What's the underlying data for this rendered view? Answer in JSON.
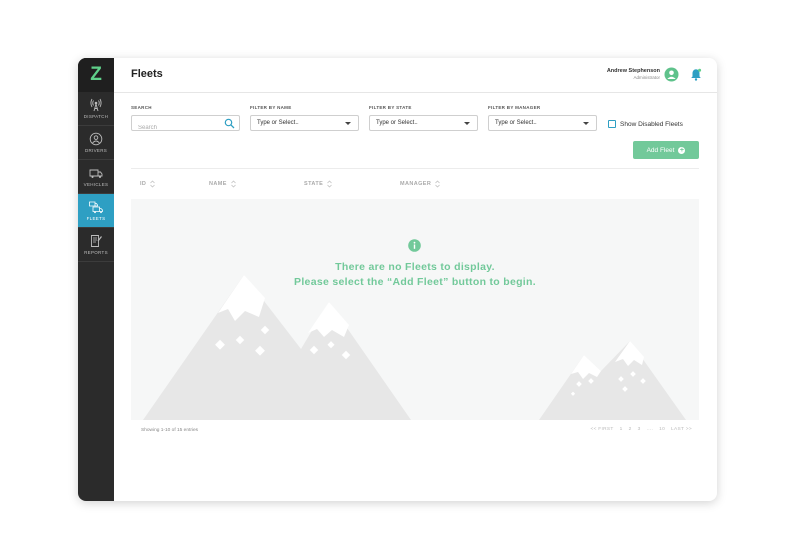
{
  "app": {
    "logo_text": "Z",
    "brand_color": "#5fd08a",
    "accent_color": "#2e9fc3"
  },
  "sidebar": {
    "items": [
      {
        "label": "DISPATCH",
        "icon": "antenna-icon"
      },
      {
        "label": "DRIVERS",
        "icon": "driver-icon"
      },
      {
        "label": "VEHICLES",
        "icon": "truck-icon"
      },
      {
        "label": "FLEETS",
        "icon": "fleet-icon",
        "active": true
      },
      {
        "label": "REPORTS",
        "icon": "report-icon"
      }
    ]
  },
  "header": {
    "title": "Fleets",
    "user_name": "Andrew Stephenson",
    "user_role": "Administrator"
  },
  "filters": {
    "search_label": "SEARCH",
    "search_placeholder": "Search",
    "name_label": "FILTER BY NAME",
    "name_value": "Type or Select..",
    "state_label": "FILTER BY STATE",
    "state_value": "Type or Select..",
    "manager_label": "FILTER BY MANAGER",
    "manager_value": "Type or Select..",
    "show_disabled_label": "Show Disabled Fleets",
    "show_disabled_checked": false
  },
  "actions": {
    "add_label": "Add Fleet"
  },
  "table": {
    "columns": [
      "ID",
      "NAME",
      "STATE",
      "MANAGER"
    ],
    "empty_line1": "There are no Fleets to display.",
    "empty_line2": "Please select the “Add Fleet” button to begin."
  },
  "footer": {
    "showing_text": "Showing 1-10 of 15 entries",
    "pager": [
      "<< FIRST",
      "1",
      "2",
      "3",
      "....",
      "10",
      "LAST >>"
    ]
  }
}
